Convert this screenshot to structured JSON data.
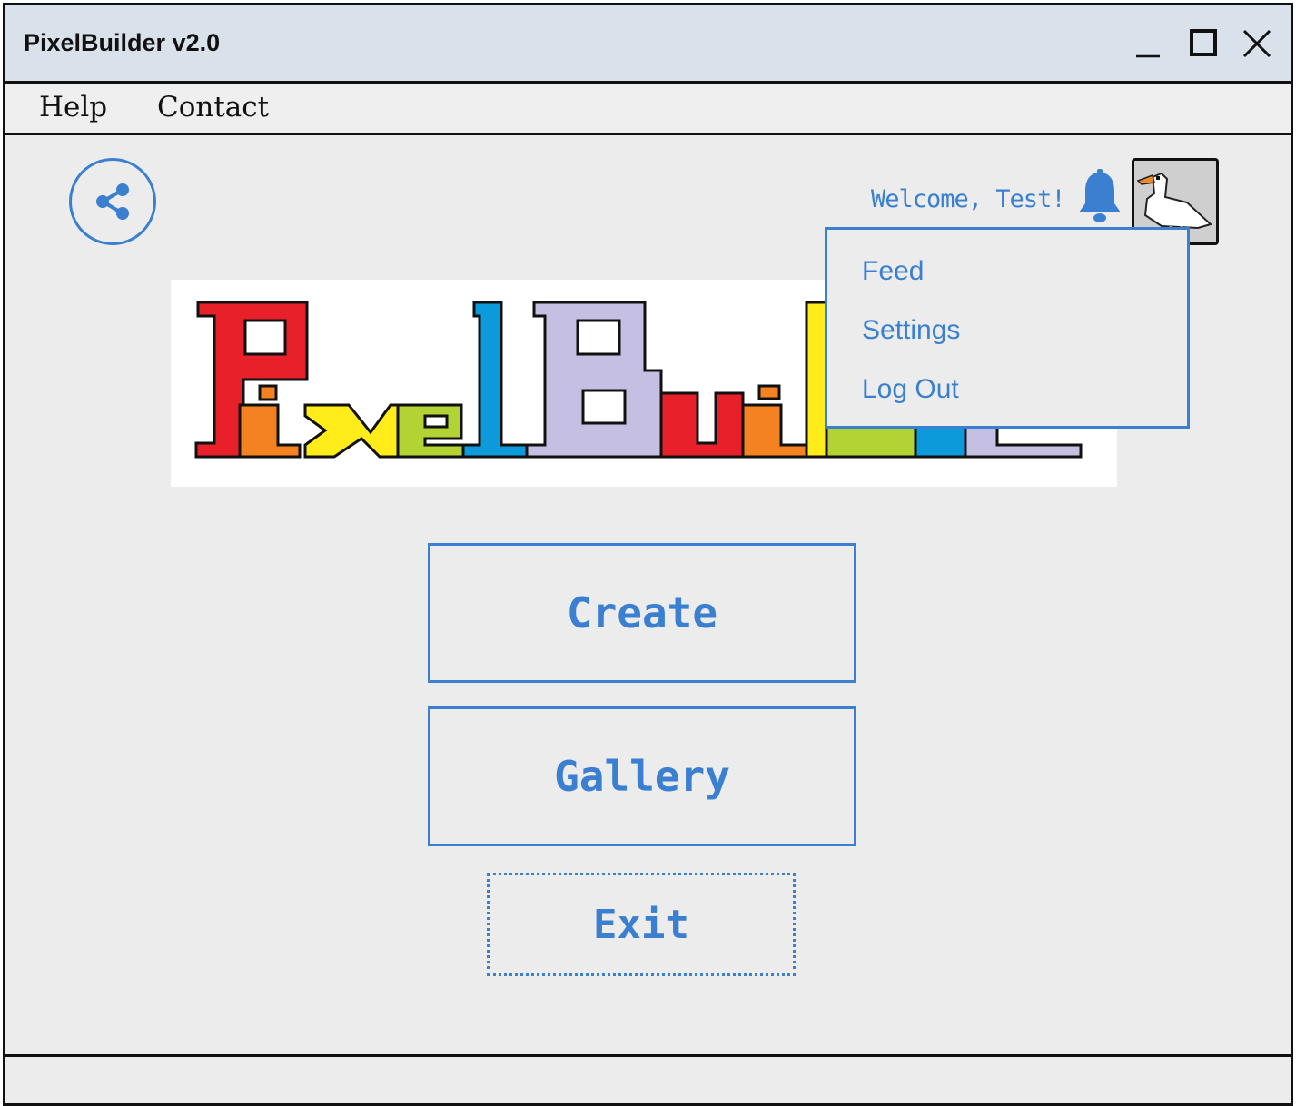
{
  "window": {
    "title": "PixelBuilder v2.0"
  },
  "menu": {
    "items": [
      "Help",
      "Contact"
    ]
  },
  "header": {
    "welcome": "Welcome, Test!"
  },
  "logo": {
    "text": "PixelBuilder"
  },
  "dropdown": {
    "items": [
      "Feed",
      "Settings",
      "Log Out"
    ]
  },
  "buttons": {
    "create": "Create",
    "gallery": "Gallery",
    "exit": "Exit"
  },
  "icons": {
    "share": "share-icon",
    "bell": "bell-icon",
    "avatar": "goose-avatar",
    "minimize": "minimize-icon",
    "maximize": "maximize-icon",
    "close": "close-icon"
  },
  "colors": {
    "accent": "#3a7fd0",
    "titlebar": "#d9e1ea",
    "background": "#ececec"
  }
}
